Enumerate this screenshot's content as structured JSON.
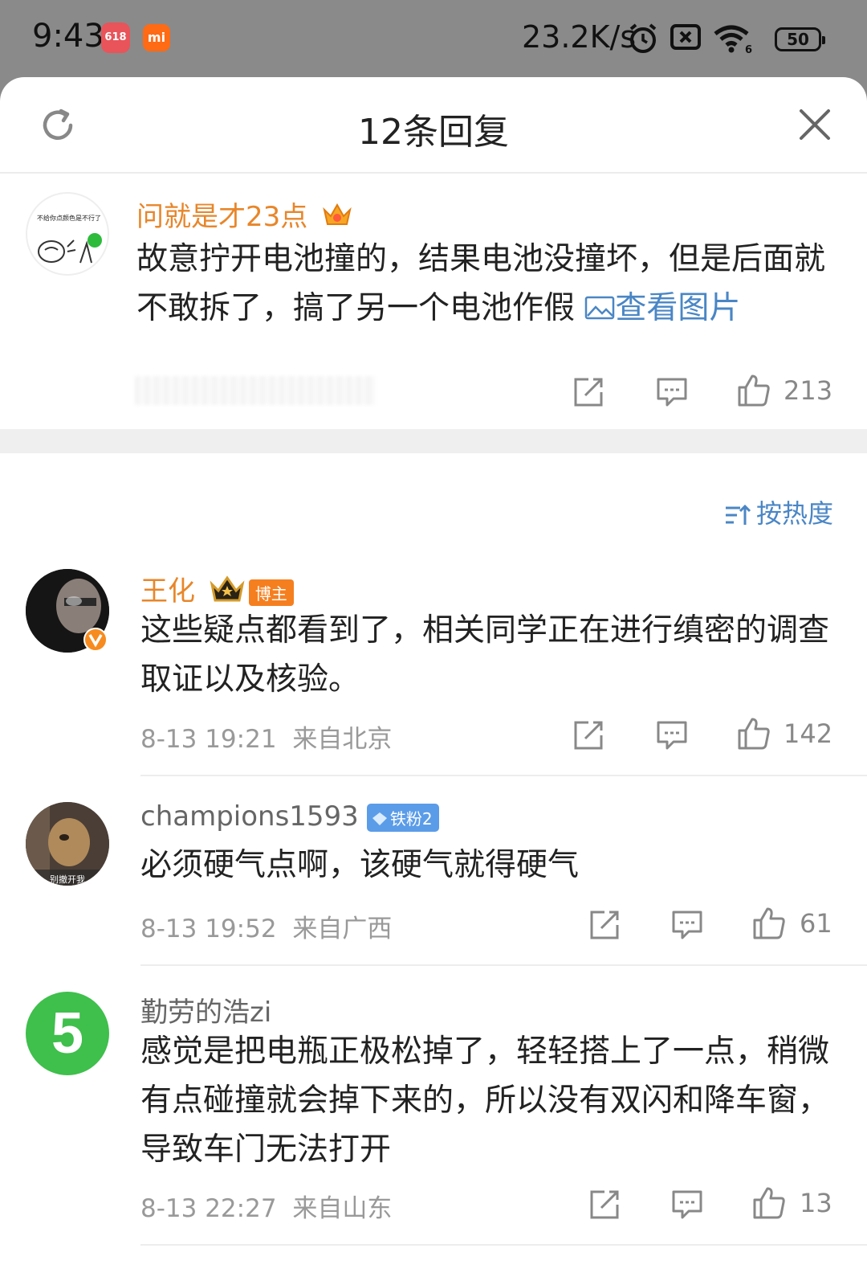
{
  "status_bar": {
    "time": "9:43",
    "app1_label": "618",
    "app2_label": "mi",
    "net_speed": "23.2K/s",
    "battery": "50"
  },
  "header": {
    "title": "12条回复"
  },
  "root_comment": {
    "username": "问就是才23点",
    "avatar_text": "不给你点颜色是不行了",
    "text": "故意拧开电池撞的，结果电池没撞坏，但是后面就不敢拆了，搞了另一个电池作假",
    "link_label": "查看图片",
    "likes": "213"
  },
  "sort": {
    "label": "按热度"
  },
  "replies": [
    {
      "username": "王化",
      "badge": "博主",
      "text": "这些疑点都看到了，相关同学正在进行缜密的调查取证以及核验。",
      "time": "8-13 19:21",
      "location": "来自北京",
      "likes": "142"
    },
    {
      "username": "champions1593",
      "badge": "铁粉2",
      "text": "必须硬气点啊，该硬气就得硬气",
      "time": "8-13 19:52",
      "location": "来自广西",
      "likes": "61"
    },
    {
      "username": "勤劳的浩zi",
      "avatar_text": "5",
      "text": "感觉是把电瓶正极松掉了，轻轻搭上了一点，稍微有点碰撞就会掉下来的，所以没有双闪和降车窗，导致车门无法打开",
      "time": "8-13 22:27",
      "location": "来自山东",
      "likes": "13"
    }
  ],
  "colors": {
    "accent_link": "#4a86c5",
    "vip_name": "#e8862a",
    "normal_name": "#666666",
    "meta": "#999999"
  }
}
